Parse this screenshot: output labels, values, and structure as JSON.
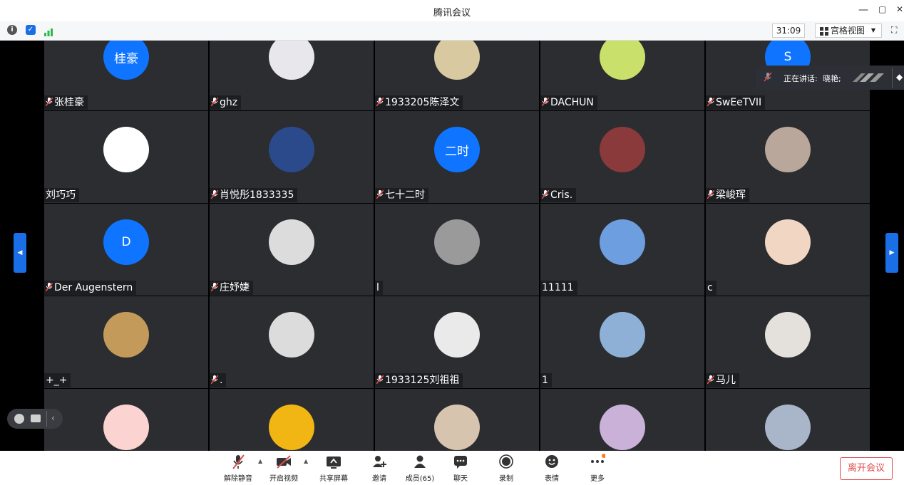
{
  "window": {
    "title": "腾讯会议",
    "minimize": "—",
    "restore": "▢",
    "close": "✕"
  },
  "infobar": {
    "timer": "31:09",
    "view_label": "宫格视图"
  },
  "speaking": {
    "prefix": "正在讲话:",
    "name": "晓艳;"
  },
  "colors": {
    "blue_avatar": "#0f74ff",
    "tile": "#2b2d31",
    "label_bg": "#1d1e21",
    "mute_red": "#e04a4a",
    "accent": "#1a6ee6"
  },
  "tiles": [
    {
      "name": "张桂豪",
      "initials": "桂豪",
      "muted": true,
      "bg": "#0f74ff"
    },
    {
      "name": "ghz",
      "initials": "",
      "muted": true,
      "bg": "#e8e8ec"
    },
    {
      "name": "1933205陈泽文",
      "initials": "",
      "muted": true,
      "bg": "#d9c9a0"
    },
    {
      "name": "DACHUN",
      "initials": "",
      "muted": true,
      "bg": "#c9e06a"
    },
    {
      "name": "SwEeTVII",
      "initials": "S",
      "muted": true,
      "bg": "#0f74ff"
    },
    {
      "name": "刘巧巧",
      "initials": "",
      "muted": false,
      "bg": "#ffffff"
    },
    {
      "name": "肖悦彤1833335",
      "initials": "",
      "muted": true,
      "bg": "#2a4a8c"
    },
    {
      "name": "七十二时",
      "initials": "二时",
      "muted": true,
      "bg": "#0f74ff"
    },
    {
      "name": "Cris.",
      "initials": "",
      "muted": true,
      "bg": "#8a3a3a"
    },
    {
      "name": "梁峻珲",
      "initials": "",
      "muted": true,
      "bg": "#b8a79a"
    },
    {
      "name": "Der Augenstern",
      "initials": "D",
      "muted": true,
      "bg": "#0f74ff"
    },
    {
      "name": "庄妤婕",
      "initials": "",
      "muted": true,
      "bg": "#dcdcdc"
    },
    {
      "name": "l",
      "initials": "",
      "muted": false,
      "bg": "#9a9a9a"
    },
    {
      "name": "11111",
      "initials": "",
      "muted": false,
      "bg": "#6d9ee0"
    },
    {
      "name": "c",
      "initials": "",
      "muted": false,
      "bg": "#f1d6c4"
    },
    {
      "name": "+_+",
      "initials": "",
      "muted": false,
      "bg": "#c49a5a"
    },
    {
      "name": ".",
      "initials": "",
      "muted": true,
      "bg": "#dcdcdc"
    },
    {
      "name": "1933125刘祖祖",
      "initials": "",
      "muted": true,
      "bg": "#eaeaea"
    },
    {
      "name": "1",
      "initials": "",
      "muted": false,
      "bg": "#8fb0d6"
    },
    {
      "name": "马儿",
      "initials": "",
      "muted": true,
      "bg": "#e4e1dc"
    },
    {
      "name": "",
      "initials": "",
      "muted": false,
      "bg": "#fbd3d1"
    },
    {
      "name": "",
      "initials": "",
      "muted": false,
      "bg": "#f2b614"
    },
    {
      "name": "",
      "initials": "",
      "muted": false,
      "bg": "#d7c4ae"
    },
    {
      "name": "",
      "initials": "",
      "muted": false,
      "bg": "#c9b1d8"
    },
    {
      "name": "",
      "initials": "",
      "muted": false,
      "bg": "#a9b6c9"
    }
  ],
  "toolbar": [
    {
      "label": "解除静音",
      "icon": "mic-muted-icon"
    },
    {
      "label": "开启视频",
      "icon": "video-off-icon"
    },
    {
      "label": "共享屏幕",
      "icon": "share-screen-icon"
    },
    {
      "label": "邀请",
      "icon": "invite-icon"
    },
    {
      "label": "成员(65)",
      "icon": "members-icon"
    },
    {
      "label": "聊天",
      "icon": "chat-icon"
    },
    {
      "label": "录制",
      "icon": "record-icon"
    },
    {
      "label": "表情",
      "icon": "emoji-icon"
    },
    {
      "label": "更多",
      "icon": "more-icon"
    }
  ],
  "leave_label": "离开会议"
}
